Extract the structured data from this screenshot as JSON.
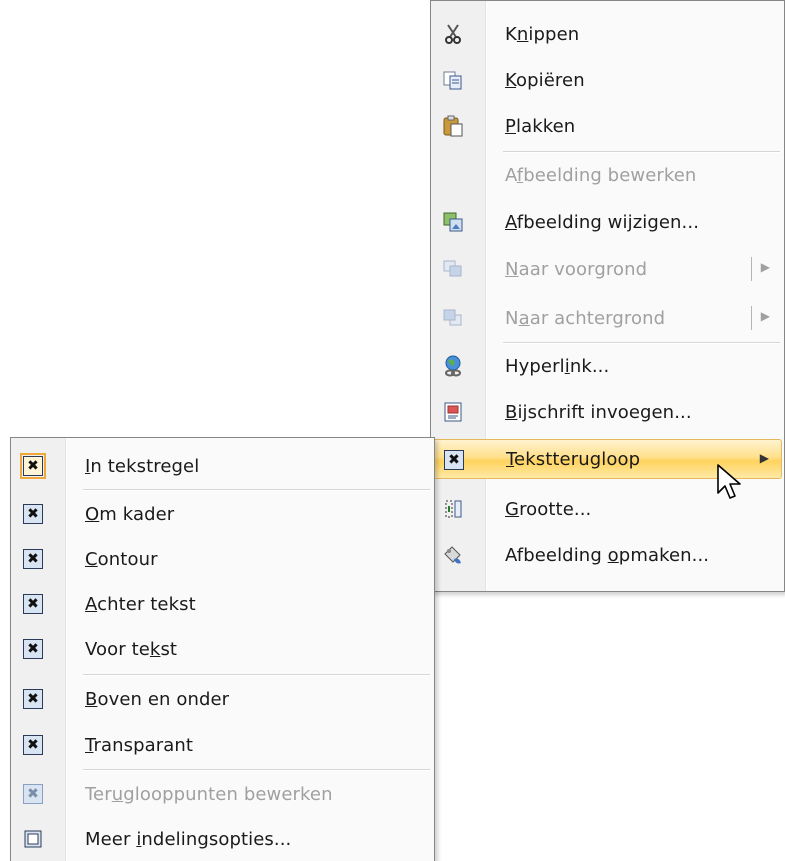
{
  "context_menu": {
    "items": [
      {
        "pre": "K",
        "ul": "n",
        "post": "ippen",
        "icon": "scissors-icon"
      },
      {
        "pre": "",
        "ul": "K",
        "post": "opiëren",
        "icon": "copy-icon"
      },
      {
        "pre": "",
        "ul": "P",
        "post": "lakken",
        "icon": "paste-icon"
      },
      {
        "pre": "A",
        "ul": "f",
        "post": "beelding bewerken",
        "icon": "none",
        "disabled": true
      },
      {
        "pre": "",
        "ul": "A",
        "post": "fbeelding wijzigen...",
        "icon": "change-picture-icon"
      },
      {
        "pre": "",
        "ul": "N",
        "post": "aar voorgrond",
        "icon": "bring-to-front-icon",
        "disabled": true
      },
      {
        "pre": "N",
        "ul": "a",
        "post": "ar achtergrond",
        "icon": "send-to-back-icon",
        "disabled": true
      },
      {
        "pre": "Hyperl",
        "ul": "i",
        "post": "nk...",
        "icon": "hyperlink-icon"
      },
      {
        "pre": "",
        "ul": "B",
        "post": "ijschrift invoegen...",
        "icon": "caption-icon"
      },
      {
        "pre": "",
        "ul": "T",
        "post": "ekstterugloop",
        "icon": "text-wrap-icon"
      },
      {
        "pre": "",
        "ul": "G",
        "post": "rootte...",
        "icon": "size-icon"
      },
      {
        "pre": "Afbeelding ",
        "ul": "o",
        "post": "pmaken...",
        "icon": "format-picture-icon"
      }
    ]
  },
  "wrap_submenu": {
    "items": [
      {
        "pre": "",
        "ul": "I",
        "post": "n tekstregel",
        "icon": "in-line-icon"
      },
      {
        "pre": "",
        "ul": "O",
        "post": "m kader",
        "icon": "square-wrap-icon"
      },
      {
        "pre": "",
        "ul": "C",
        "post": "ontour",
        "icon": "tight-wrap-icon"
      },
      {
        "pre": "",
        "ul": "A",
        "post": "chter tekst",
        "icon": "behind-text-icon"
      },
      {
        "pre": "Voor te",
        "ul": "k",
        "post": "st",
        "icon": "in-front-of-text-icon"
      },
      {
        "pre": "",
        "ul": "B",
        "post": "oven en onder",
        "icon": "top-bottom-icon"
      },
      {
        "pre": "",
        "ul": "T",
        "post": "ransparant",
        "icon": "through-icon"
      },
      {
        "pre": "Ter",
        "ul": "u",
        "post": "glooppunten bewerken",
        "icon": "edit-wrap-points-icon",
        "disabled": true
      },
      {
        "pre": "Meer ",
        "ul": "i",
        "post": "ndelingsopties...",
        "icon": "more-layout-icon"
      }
    ]
  },
  "glyphs": {
    "submenu_arrow": "▶",
    "wrap_mark": "✖"
  },
  "colors": {
    "highlight_border": "#e5b95b",
    "highlight_fill": "#ffe08c",
    "disabled_text": "#a0a0a0"
  }
}
